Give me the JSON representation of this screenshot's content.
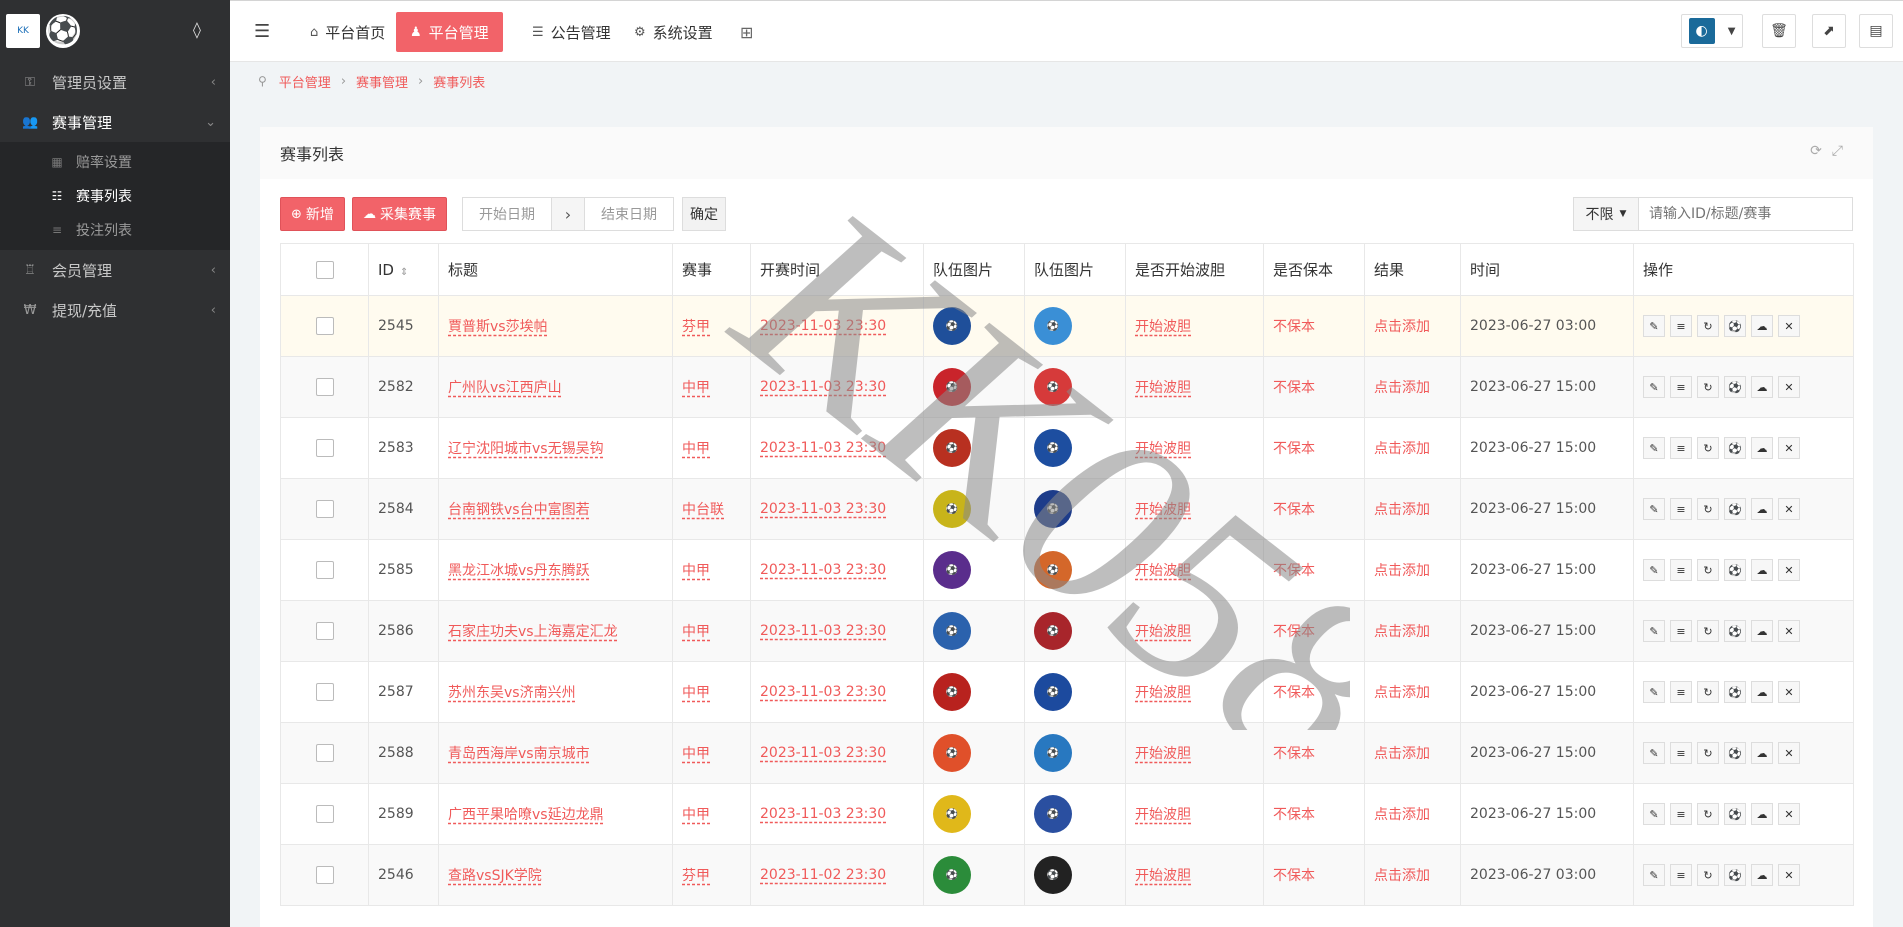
{
  "sidebar": {
    "logo_text": "KK",
    "items": [
      {
        "label": "管理员设置",
        "icon": "key-icon"
      },
      {
        "label": "赛事管理",
        "icon": "users-icon",
        "active": true
      },
      {
        "label": "会员管理",
        "icon": "trophy-icon"
      },
      {
        "label": "提现/充值",
        "icon": "won-icon"
      }
    ],
    "sub_items": [
      {
        "label": "赔率设置"
      },
      {
        "label": "赛事列表",
        "active": true
      },
      {
        "label": "投注列表"
      }
    ]
  },
  "topbar": {
    "tabs": [
      {
        "label": "平台首页",
        "icon": "home-icon"
      },
      {
        "label": "平台管理",
        "icon": "user-icon",
        "active": true
      },
      {
        "label": "公告管理",
        "icon": "list-icon"
      },
      {
        "label": "系统设置",
        "icon": "gear-icon"
      }
    ]
  },
  "breadcrumb": [
    "平台管理",
    "赛事管理",
    "赛事列表"
  ],
  "panel": {
    "title": "赛事列表",
    "add_label": "新增",
    "collect_label": "采集赛事",
    "start_date_placeholder": "开始日期",
    "end_date_placeholder": "结束日期",
    "confirm_label": "确定",
    "filter_label": "不限",
    "search_placeholder": "请输入ID/标题/赛事"
  },
  "table": {
    "headers": [
      "ID",
      "标题",
      "赛事",
      "开赛时间",
      "队伍图片",
      "队伍图片",
      "是否开始波胆",
      "是否保本",
      "结果",
      "时间",
      "操作"
    ],
    "rows": [
      {
        "id": "2545",
        "title": "賈普斯vs莎埃帕",
        "league": "芬甲",
        "start": "2023-11-03 23:30",
        "bodan": "开始波胆",
        "baoben": "不保本",
        "result": "点击添加",
        "time": "2023-06-27 03:00",
        "c1": "#1f4f9a",
        "c2": "#3a8fd6"
      },
      {
        "id": "2582",
        "title": "广州队vs江西庐山",
        "league": "中甲",
        "start": "2023-11-03 23:30",
        "bodan": "开始波胆",
        "baoben": "不保本",
        "result": "点击添加",
        "time": "2023-06-27 15:00",
        "c1": "#c9242b",
        "c2": "#d63a3a"
      },
      {
        "id": "2583",
        "title": "辽宁沈阳城市vs无锡吴钩",
        "league": "中甲",
        "start": "2023-11-03 23:30",
        "bodan": "开始波胆",
        "baoben": "不保本",
        "result": "点击添加",
        "time": "2023-06-27 15:00",
        "c1": "#b83020",
        "c2": "#1d4ea0"
      },
      {
        "id": "2584",
        "title": "台南钢铁vs台中富图若",
        "league": "中台联",
        "start": "2023-11-03 23:30",
        "bodan": "开始波胆",
        "baoben": "不保本",
        "result": "点击添加",
        "time": "2023-06-27 15:00",
        "c1": "#c8b41a",
        "c2": "#1d3c8a"
      },
      {
        "id": "2585",
        "title": "黑龙江冰城vs丹东腾跃",
        "league": "中甲",
        "start": "2023-11-03 23:30",
        "bodan": "开始波胆",
        "baoben": "不保本",
        "result": "点击添加",
        "time": "2023-06-27 15:00",
        "c1": "#5a2d8c",
        "c2": "#d4672a"
      },
      {
        "id": "2586",
        "title": "石家庄功夫vs上海嘉定汇龙",
        "league": "中甲",
        "start": "2023-11-03 23:30",
        "bodan": "开始波胆",
        "baoben": "不保本",
        "result": "点击添加",
        "time": "2023-06-27 15:00",
        "c1": "#2b62ad",
        "c2": "#a8252b"
      },
      {
        "id": "2587",
        "title": "苏州东吴vs济南兴州",
        "league": "中甲",
        "start": "2023-11-03 23:30",
        "bodan": "开始波胆",
        "baoben": "不保本",
        "result": "点击添加",
        "time": "2023-06-27 15:00",
        "c1": "#b8221e",
        "c2": "#1c4a9e"
      },
      {
        "id": "2588",
        "title": "青岛西海岸vs南京城市",
        "league": "中甲",
        "start": "2023-11-03 23:30",
        "bodan": "开始波胆",
        "baoben": "不保本",
        "result": "点击添加",
        "time": "2023-06-27 15:00",
        "c1": "#e0502a",
        "c2": "#2878c0"
      },
      {
        "id": "2589",
        "title": "广西平果哈嘹vs延边龙鼎",
        "league": "中甲",
        "start": "2023-11-03 23:30",
        "bodan": "开始波胆",
        "baoben": "不保本",
        "result": "点击添加",
        "time": "2023-06-27 15:00",
        "c1": "#e0b81a",
        "c2": "#2a4fa0"
      },
      {
        "id": "2546",
        "title": "查路vsSJK学院",
        "league": "芬甲",
        "start": "2023-11-02 23:30",
        "bodan": "开始波胆",
        "baoben": "不保本",
        "result": "点击添加",
        "time": "2023-06-27 03:00",
        "c1": "#2b8c3a",
        "c2": "#222222"
      }
    ]
  },
  "watermark_text": "KK058"
}
